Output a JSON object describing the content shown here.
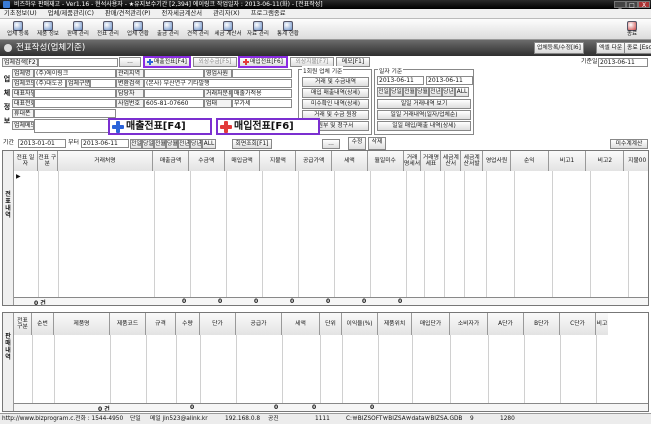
{
  "window": {
    "title": "비즈하우 판매재고 - Ver1.16 - 현석사용자 - ★유지보수기간 [2,394] 에이링크       작업일자 : 2013-06-11(화) - [전표작성]",
    "min": "_",
    "max": "□",
    "close": "X"
  },
  "menu": [
    "기초정보(U)",
    "업체/제품관리(C)",
    "판매/견적관리(P)",
    "전자세금계산서",
    "관리자(X)",
    "프로그램종료"
  ],
  "toolbar": [
    "업체 등록",
    "제품 정보",
    "판매 관리",
    "전표 관리",
    "업체 현황",
    "출금 관리",
    "견적 관리",
    "세금 계산서",
    "자료 관리",
    "통계 현황",
    "종료"
  ],
  "header": {
    "title": "전표작성(업체기준)",
    "buttons": [
      "업체등록/수정[I6]",
      "엑셀 다운",
      "종료 [Esc]"
    ]
  },
  "search": {
    "label": "업체검색[F2]",
    "tabs": [
      "매출전표[F4]",
      "외상수금[F5]",
      "매입전표[F6]",
      "외상지불[F7]",
      "메모[F1]"
    ],
    "date_label": "기준일",
    "date_value": "2013-06-11"
  },
  "company": {
    "side_label": "업체정보",
    "rows": [
      [
        "업체명",
        "(주)에이링크",
        "관리지역",
        "",
        "영업사원",
        ""
      ],
      [
        "업체코드",
        "(주)대도공",
        "업체구분",
        "",
        "변환검색",
        "(본사) 부산연구 기타발행"
      ],
      [
        "대표자명",
        "",
        "담당자",
        "",
        "거래처분류",
        "매출가적용"
      ],
      [
        "대표전화",
        "",
        "사업번호",
        "605-81-07660",
        "업태",
        "부가세"
      ],
      [
        "휴대폰",
        "",
        "",
        "",
        "",
        ""
      ],
      [
        "업체메모",
        "",
        "",
        "",
        "",
        ""
      ]
    ]
  },
  "query_panel": {
    "title": "1회원 업체 기준",
    "buttons": [
      "거래 및 수금내역",
      "매입 매출내역(상세)",
      "미수확인 내역(상세)",
      "거래 및 수금 원장",
      "원부 및 청구서"
    ]
  },
  "date_panel": {
    "title": "일자 기준",
    "from": "2013-06-11",
    "to": "2013-06-11",
    "quick": [
      "전일",
      "당일",
      "전월",
      "당월",
      "전년",
      "당년",
      "ALL"
    ],
    "buttons": [
      "일일 거래내역 보기",
      "일일 거래내역(일자/업체순)",
      "일일 매입/매출 내역(상세)"
    ]
  },
  "overlay": {
    "sales": "매출전표[F4]",
    "purchase": "매입전표[F6]"
  },
  "period": {
    "label": "기간",
    "from": "2013-01-01",
    "to_label": "부터",
    "to": "2013-06-11",
    "quick": [
      "전일",
      "당일",
      "전월",
      "당월",
      "전년",
      "당년",
      "ALL"
    ],
    "actions": [
      "회면조회[F1]"
    ],
    "right_buttons": [
      "수정",
      "삭제",
      "미수계계산"
    ]
  },
  "voucher_grid": {
    "side_label": "전표내역",
    "columns": [
      "전표 일자",
      "전표 구분",
      "거래처명",
      "매출금액",
      "수금액",
      "매입금액",
      "지불액",
      "공급가액",
      "세액",
      "월일미수",
      "거래 명세서",
      "거래명 세표",
      "세금계 산서",
      "세금계 산서발",
      "영업사원",
      "순익",
      "비고1",
      "비고2",
      "지불00"
    ],
    "footer": {
      "count": "0 건",
      "sums": [
        "0",
        "0",
        "0",
        "0",
        "0",
        "0",
        "0"
      ]
    }
  },
  "detail_grid": {
    "side_label": "판매내역",
    "columns": [
      "전표 구분",
      "순번",
      "제품명",
      "제품코드",
      "규격",
      "수량",
      "단가",
      "공급가",
      "세액",
      "단위",
      "이익율(%)",
      "제품위치",
      "매입단가",
      "소비자가",
      "A단가",
      "B단가",
      "C단가",
      "비고"
    ],
    "footer": {
      "count": "0 건",
      "sums": [
        "0",
        "0",
        "0",
        "0"
      ]
    }
  },
  "statusbar": [
    "http://www.bizprogram.c.전화 : 1544-4950",
    "단일",
    "메일 jin523@alink.kr",
    "192.168.0.8",
    "공진",
    "1111",
    "C:￦BIZSOFT￦BIZSA￦data￦BIZSA.GDB",
    "9",
    "1280"
  ]
}
